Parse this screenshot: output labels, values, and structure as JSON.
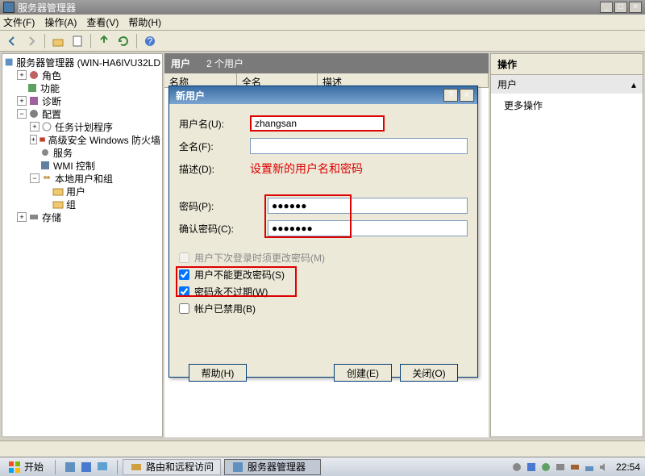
{
  "window": {
    "title": "服务器管理器",
    "min": "_",
    "max": "□",
    "close": "×"
  },
  "menu": {
    "file": "文件(F)",
    "action": "操作(A)",
    "view": "查看(V)",
    "help": "帮助(H)"
  },
  "tree": {
    "root": "服务器管理器 (WIN-HA6IVU32LD",
    "roles": "角色",
    "features": "功能",
    "diagnostics": "诊断",
    "config": "配置",
    "task_scheduler": "任务计划程序",
    "firewall": "高级安全 Windows 防火墙",
    "services": "服务",
    "wmi": "WMI 控制",
    "local_users": "本地用户和组",
    "users": "用户",
    "groups": "组",
    "storage": "存储"
  },
  "center": {
    "title": "用户",
    "count": "2 个用户",
    "col_name": "名称",
    "col_fullname": "全名",
    "col_desc": "描述"
  },
  "actions": {
    "title": "操作",
    "sub": "用户",
    "more": "更多操作"
  },
  "dialog": {
    "title": "新用户",
    "username_label": "用户名(U):",
    "username_value": "zhangsan",
    "fullname_label": "全名(F):",
    "desc_label": "描述(D):",
    "annotation": "设置新的用户名和密码",
    "password_label": "密码(P):",
    "password_value": "●●●●●●",
    "confirm_label": "确认密码(C):",
    "confirm_value": "●●●●●●●",
    "must_change": "用户下次登录时须更改密码(M)",
    "cannot_change": "用户不能更改密码(S)",
    "never_expire": "密码永不过期(W)",
    "disabled": "帐户已禁用(B)",
    "help_btn": "帮助(H)",
    "create_btn": "创建(E)",
    "close_btn": "关闭(O)",
    "help_q": "?",
    "close_x": "×"
  },
  "taskbar": {
    "start": "开始",
    "task1": "路由和远程访问",
    "task2": "服务器管理器",
    "clock": "22:54"
  }
}
